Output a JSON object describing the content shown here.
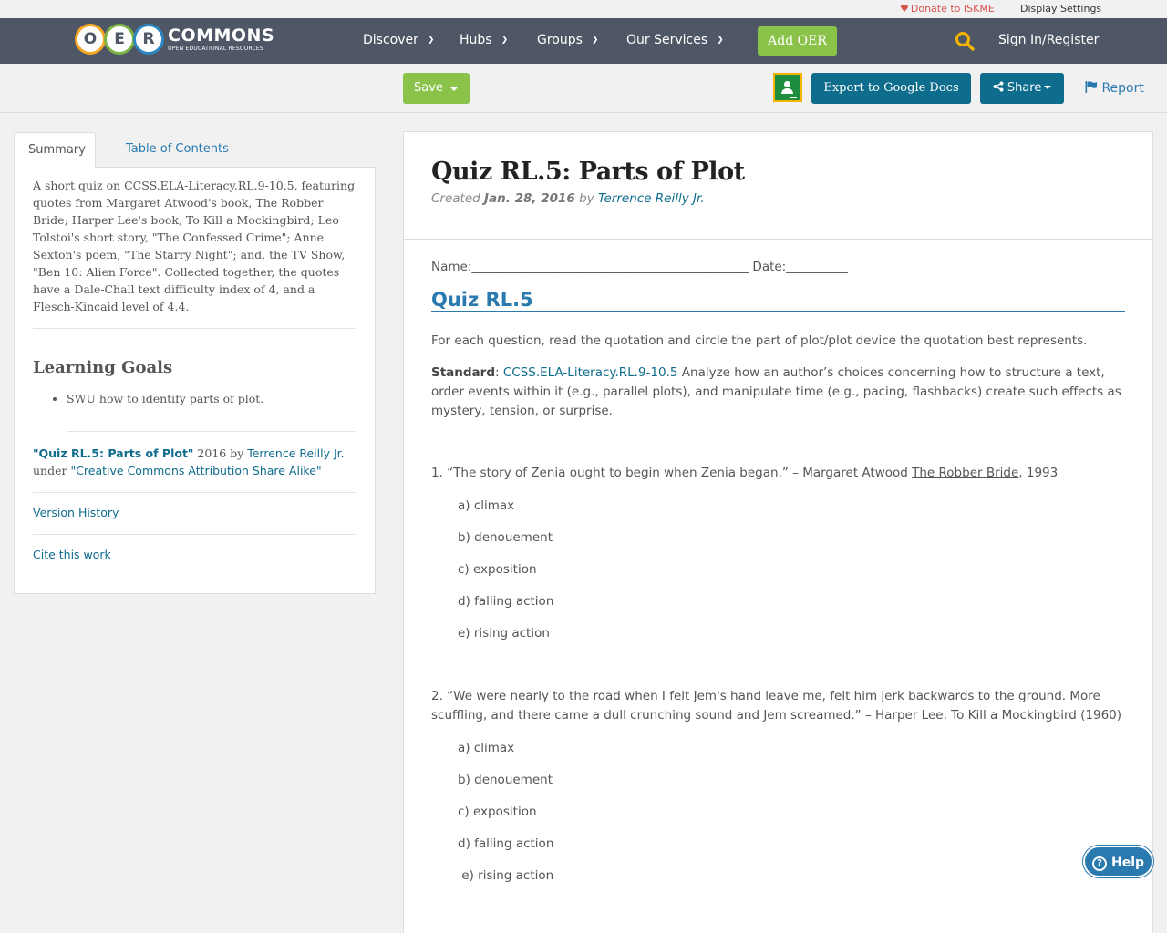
{
  "utility": {
    "donate": "Donate to ISKME",
    "display_settings": "Display Settings"
  },
  "logo": {
    "letters": [
      "O",
      "E",
      "R"
    ],
    "word": "COMMONS",
    "tagline": "OPEN EDUCATIONAL RESOURCES"
  },
  "nav": {
    "items": [
      "Discover",
      "Hubs",
      "Groups",
      "Our Services"
    ],
    "add_oer": "Add OER",
    "signin": "Sign In/Register"
  },
  "toolbar": {
    "save": "Save",
    "export": "Export to Google Docs",
    "share": "Share",
    "report": "Report"
  },
  "colors": {
    "nav_bg": "#4f5666",
    "green": "#8bc34a",
    "teal": "#0e6c8c",
    "link": "#2a7ab0"
  },
  "sidebar": {
    "tabs": [
      "Summary",
      "Table of Contents"
    ],
    "summary": "A short quiz on CCSS.ELA-Literacy.RL.9-10.5, featuring quotes from Margaret Atwood's book, The Robber Bride; Harper Lee's book, To Kill a Mockingbird; Leo Tolstoi's short story, \"The Confessed Crime\"; Anne Sexton's poem, \"The Starry Night\"; and, the TV Show, \"Ben 10: Alien Force\". Collected together, the quotes have a Dale-Chall text difficulty index of 4, and a Flesch-Kincaid level of 4.4.",
    "learning_goals_title": "Learning Goals",
    "learning_goals": [
      "SWU how to identify parts of plot."
    ],
    "attribution": {
      "title": "\"Quiz RL.5: Parts of Plot\"",
      "year_by": " 2016 by ",
      "author": "Terrence Reilly Jr.",
      "under": "under ",
      "license": "\"Creative Commons Attribution Share Alike\""
    },
    "version_history": "Version History",
    "cite": "Cite this work"
  },
  "main": {
    "title": "Quiz RL.5: Parts of Plot",
    "created_label": "Created ",
    "created_date": "Jan. 28, 2016",
    "by": " by ",
    "author": "Terrence Reilly Jr.",
    "name_date": "Name:_____________________________________________ Date:__________",
    "quiz_heading": "Quiz RL.5",
    "instructions": "For each question, read the quotation and circle the part of plot/plot device the quotation best represents.",
    "standard_label": "Standard",
    "standard_code": "CCSS.ELA-Literacy.RL.9-10.5",
    "standard_text": " Analyze how an author’s choices concerning how to structure a text, order events within it (e.g., parallel plots), and manipulate time (e.g., pacing, flashbacks) create such effects as mystery, tension, or surprise.",
    "q1_pre": "1. “The story of Zenia ought to begin when Zenia began.” – Margaret Atwood ",
    "q1_book": "The Robber Bride",
    "q1_post": ", 1993",
    "q2": "2. “We were nearly to the road when I felt Jem's hand leave me, felt him jerk backwards to the ground.  More scuffling, and there came a dull crunching sound and Jem screamed.” – Harper Lee, To Kill a Mockingbird (1960)",
    "options": [
      "a) climax",
      "b) denouement",
      "c) exposition",
      "d) falling action",
      "e) rising action"
    ],
    "q2_last_option": " e) rising action"
  },
  "help": "Help"
}
